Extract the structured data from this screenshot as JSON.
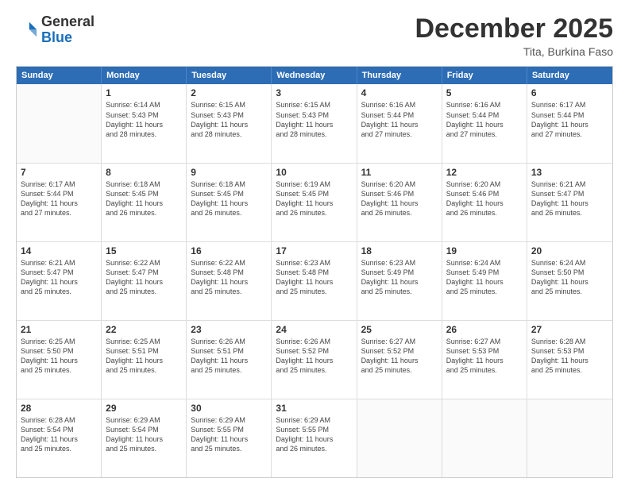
{
  "header": {
    "logo_general": "General",
    "logo_blue": "Blue",
    "month_title": "December 2025",
    "location": "Tita, Burkina Faso"
  },
  "weekdays": [
    "Sunday",
    "Monday",
    "Tuesday",
    "Wednesday",
    "Thursday",
    "Friday",
    "Saturday"
  ],
  "rows": [
    [
      {
        "day": "",
        "sunrise": "",
        "sunset": "",
        "daylight": ""
      },
      {
        "day": "1",
        "sunrise": "Sunrise: 6:14 AM",
        "sunset": "Sunset: 5:43 PM",
        "daylight": "Daylight: 11 hours and 28 minutes."
      },
      {
        "day": "2",
        "sunrise": "Sunrise: 6:15 AM",
        "sunset": "Sunset: 5:43 PM",
        "daylight": "Daylight: 11 hours and 28 minutes."
      },
      {
        "day": "3",
        "sunrise": "Sunrise: 6:15 AM",
        "sunset": "Sunset: 5:43 PM",
        "daylight": "Daylight: 11 hours and 28 minutes."
      },
      {
        "day": "4",
        "sunrise": "Sunrise: 6:16 AM",
        "sunset": "Sunset: 5:44 PM",
        "daylight": "Daylight: 11 hours and 27 minutes."
      },
      {
        "day": "5",
        "sunrise": "Sunrise: 6:16 AM",
        "sunset": "Sunset: 5:44 PM",
        "daylight": "Daylight: 11 hours and 27 minutes."
      },
      {
        "day": "6",
        "sunrise": "Sunrise: 6:17 AM",
        "sunset": "Sunset: 5:44 PM",
        "daylight": "Daylight: 11 hours and 27 minutes."
      }
    ],
    [
      {
        "day": "7",
        "sunrise": "Sunrise: 6:17 AM",
        "sunset": "Sunset: 5:44 PM",
        "daylight": "Daylight: 11 hours and 27 minutes."
      },
      {
        "day": "8",
        "sunrise": "Sunrise: 6:18 AM",
        "sunset": "Sunset: 5:45 PM",
        "daylight": "Daylight: 11 hours and 26 minutes."
      },
      {
        "day": "9",
        "sunrise": "Sunrise: 6:18 AM",
        "sunset": "Sunset: 5:45 PM",
        "daylight": "Daylight: 11 hours and 26 minutes."
      },
      {
        "day": "10",
        "sunrise": "Sunrise: 6:19 AM",
        "sunset": "Sunset: 5:45 PM",
        "daylight": "Daylight: 11 hours and 26 minutes."
      },
      {
        "day": "11",
        "sunrise": "Sunrise: 6:20 AM",
        "sunset": "Sunset: 5:46 PM",
        "daylight": "Daylight: 11 hours and 26 minutes."
      },
      {
        "day": "12",
        "sunrise": "Sunrise: 6:20 AM",
        "sunset": "Sunset: 5:46 PM",
        "daylight": "Daylight: 11 hours and 26 minutes."
      },
      {
        "day": "13",
        "sunrise": "Sunrise: 6:21 AM",
        "sunset": "Sunset: 5:47 PM",
        "daylight": "Daylight: 11 hours and 26 minutes."
      }
    ],
    [
      {
        "day": "14",
        "sunrise": "Sunrise: 6:21 AM",
        "sunset": "Sunset: 5:47 PM",
        "daylight": "Daylight: 11 hours and 25 minutes."
      },
      {
        "day": "15",
        "sunrise": "Sunrise: 6:22 AM",
        "sunset": "Sunset: 5:47 PM",
        "daylight": "Daylight: 11 hours and 25 minutes."
      },
      {
        "day": "16",
        "sunrise": "Sunrise: 6:22 AM",
        "sunset": "Sunset: 5:48 PM",
        "daylight": "Daylight: 11 hours and 25 minutes."
      },
      {
        "day": "17",
        "sunrise": "Sunrise: 6:23 AM",
        "sunset": "Sunset: 5:48 PM",
        "daylight": "Daylight: 11 hours and 25 minutes."
      },
      {
        "day": "18",
        "sunrise": "Sunrise: 6:23 AM",
        "sunset": "Sunset: 5:49 PM",
        "daylight": "Daylight: 11 hours and 25 minutes."
      },
      {
        "day": "19",
        "sunrise": "Sunrise: 6:24 AM",
        "sunset": "Sunset: 5:49 PM",
        "daylight": "Daylight: 11 hours and 25 minutes."
      },
      {
        "day": "20",
        "sunrise": "Sunrise: 6:24 AM",
        "sunset": "Sunset: 5:50 PM",
        "daylight": "Daylight: 11 hours and 25 minutes."
      }
    ],
    [
      {
        "day": "21",
        "sunrise": "Sunrise: 6:25 AM",
        "sunset": "Sunset: 5:50 PM",
        "daylight": "Daylight: 11 hours and 25 minutes."
      },
      {
        "day": "22",
        "sunrise": "Sunrise: 6:25 AM",
        "sunset": "Sunset: 5:51 PM",
        "daylight": "Daylight: 11 hours and 25 minutes."
      },
      {
        "day": "23",
        "sunrise": "Sunrise: 6:26 AM",
        "sunset": "Sunset: 5:51 PM",
        "daylight": "Daylight: 11 hours and 25 minutes."
      },
      {
        "day": "24",
        "sunrise": "Sunrise: 6:26 AM",
        "sunset": "Sunset: 5:52 PM",
        "daylight": "Daylight: 11 hours and 25 minutes."
      },
      {
        "day": "25",
        "sunrise": "Sunrise: 6:27 AM",
        "sunset": "Sunset: 5:52 PM",
        "daylight": "Daylight: 11 hours and 25 minutes."
      },
      {
        "day": "26",
        "sunrise": "Sunrise: 6:27 AM",
        "sunset": "Sunset: 5:53 PM",
        "daylight": "Daylight: 11 hours and 25 minutes."
      },
      {
        "day": "27",
        "sunrise": "Sunrise: 6:28 AM",
        "sunset": "Sunset: 5:53 PM",
        "daylight": "Daylight: 11 hours and 25 minutes."
      }
    ],
    [
      {
        "day": "28",
        "sunrise": "Sunrise: 6:28 AM",
        "sunset": "Sunset: 5:54 PM",
        "daylight": "Daylight: 11 hours and 25 minutes."
      },
      {
        "day": "29",
        "sunrise": "Sunrise: 6:29 AM",
        "sunset": "Sunset: 5:54 PM",
        "daylight": "Daylight: 11 hours and 25 minutes."
      },
      {
        "day": "30",
        "sunrise": "Sunrise: 6:29 AM",
        "sunset": "Sunset: 5:55 PM",
        "daylight": "Daylight: 11 hours and 25 minutes."
      },
      {
        "day": "31",
        "sunrise": "Sunrise: 6:29 AM",
        "sunset": "Sunset: 5:55 PM",
        "daylight": "Daylight: 11 hours and 26 minutes."
      },
      {
        "day": "",
        "sunrise": "",
        "sunset": "",
        "daylight": ""
      },
      {
        "day": "",
        "sunrise": "",
        "sunset": "",
        "daylight": ""
      },
      {
        "day": "",
        "sunrise": "",
        "sunset": "",
        "daylight": ""
      }
    ]
  ]
}
